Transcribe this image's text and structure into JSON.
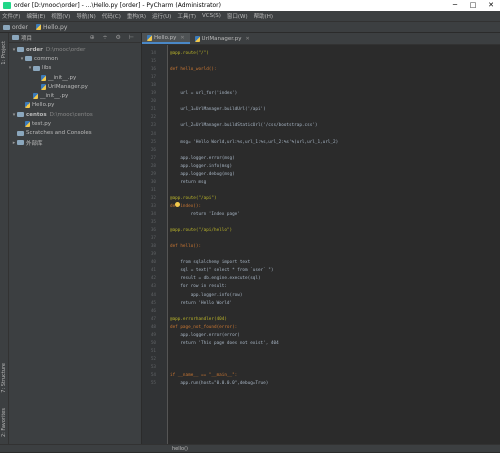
{
  "window": {
    "title": "order [D:\\mooc\\order] - ...\\Hello.py [order] - PyCharm (Administrator)",
    "controls": [
      "─",
      "□",
      "✕"
    ]
  },
  "menu": [
    "文件(F)",
    "编辑(E)",
    "视图(V)",
    "导航(N)",
    "代码(C)",
    "重构(R)",
    "运行(U)",
    "工具(T)",
    "VCS(S)",
    "窗口(W)",
    "帮助(H)"
  ],
  "nav": {
    "project": "order",
    "file": "Hello.py"
  },
  "left_strip": {
    "project": "1: Project",
    "structure": "7: Structure",
    "favorites": "2: Favorites"
  },
  "project_panel": {
    "title": "项目",
    "tools": "⊕ ÷ ⚙ ⊢",
    "tree": [
      {
        "label": "order",
        "path": "D:\\mooc\\order",
        "arrow": "▾",
        "indent": 0,
        "icon": "folder-icon"
      },
      {
        "label": "common",
        "path": "",
        "arrow": "▾",
        "indent": 1,
        "icon": "folder-icon"
      },
      {
        "label": "libs",
        "path": "",
        "arrow": "▾",
        "indent": 2,
        "icon": "folder-icon"
      },
      {
        "label": "__init__.py",
        "path": "",
        "arrow": "",
        "indent": 3,
        "icon": "python-file-icon"
      },
      {
        "label": "UrlManager.py",
        "path": "",
        "arrow": "",
        "indent": 3,
        "icon": "python-file-icon"
      },
      {
        "label": "__init__.py",
        "path": "",
        "arrow": "",
        "indent": 2,
        "icon": "python-file-icon"
      },
      {
        "label": "Hello.py",
        "path": "",
        "arrow": "",
        "indent": 1,
        "icon": "python-file-icon"
      },
      {
        "label": "centos",
        "path": "D:\\mooc\\centos",
        "arrow": "▾",
        "indent": 0,
        "icon": "folder-icon"
      },
      {
        "label": "test.py",
        "path": "",
        "arrow": "",
        "indent": 1,
        "icon": "python-file-icon"
      },
      {
        "label": "Scratches and Consoles",
        "path": "",
        "arrow": "",
        "indent": 0,
        "icon": "scratches-icon"
      },
      {
        "label": "外部库",
        "path": "",
        "arrow": "▸",
        "indent": 0,
        "icon": "library-icon"
      }
    ]
  },
  "tabs": [
    {
      "label": "Hello.py",
      "active": true
    },
    {
      "label": "UrlManager.py",
      "active": false
    }
  ],
  "code": {
    "line_numbers": [
      "14",
      "15",
      "16",
      "17",
      "18",
      "19",
      "20",
      "21",
      "22",
      "23",
      "24",
      "25",
      "26",
      "27",
      "28",
      "29",
      "30",
      "31",
      "32",
      "33",
      "34",
      "35",
      "36",
      "37",
      "38",
      "39",
      "40",
      "41",
      "42",
      "43",
      "44",
      "45",
      "46",
      "47",
      "48",
      "49",
      "50",
      "51",
      "52",
      "53",
      "54",
      "55",
      "56",
      "57",
      "58",
      "59",
      "60"
    ],
    "lines": [
      {
        "t": "@app.route(\"/\")",
        "c": "dec"
      },
      {
        "t": "",
        "c": ""
      },
      {
        "t": "def hello_world():",
        "c": "kw"
      },
      {
        "t": "",
        "c": ""
      },
      {
        "t": "",
        "c": ""
      },
      {
        "t": "    url = url_for('index')",
        "c": ""
      },
      {
        "t": "",
        "c": ""
      },
      {
        "t": "    url_1=UrlManager.buildUrl('/api')",
        "c": ""
      },
      {
        "t": "",
        "c": ""
      },
      {
        "t": "    url_2=UrlManager.buildStaticUrl('/css/bootstrap.css')",
        "c": ""
      },
      {
        "t": "",
        "c": ""
      },
      {
        "t": "    msg= 'Hello World,url:%s,url_1:%s,url_2:%s'%(url,url_1,url_2)",
        "c": ""
      },
      {
        "t": "",
        "c": ""
      },
      {
        "t": "    app.logger.error(msg)",
        "c": ""
      },
      {
        "t": "    app.logger.info(msg)",
        "c": ""
      },
      {
        "t": "    app.logger.debug(msg)",
        "c": ""
      },
      {
        "t": "    return msg",
        "c": ""
      },
      {
        "t": "",
        "c": ""
      },
      {
        "t": "@app.route(\"/api\")",
        "c": "dec"
      },
      {
        "t": "def index():",
        "c": "kw"
      },
      {
        "t": "        return 'Index page'",
        "c": ""
      },
      {
        "t": "",
        "c": ""
      },
      {
        "t": "@app.route(\"/api/hello\")",
        "c": "dec"
      },
      {
        "t": "",
        "c": ""
      },
      {
        "t": "def hello():",
        "c": "kw"
      },
      {
        "t": "",
        "c": ""
      },
      {
        "t": "    from sqlalchemy import text",
        "c": ""
      },
      {
        "t": "    sql = text(\" select * from `user` \")",
        "c": ""
      },
      {
        "t": "    result = db.engine.execute(sql)",
        "c": ""
      },
      {
        "t": "    for row in result:",
        "c": ""
      },
      {
        "t": "        app.logger.info(row)",
        "c": ""
      },
      {
        "t": "    return 'Hello World'",
        "c": ""
      },
      {
        "t": "",
        "c": ""
      },
      {
        "t": "@app.errorhandler(404)",
        "c": "dec"
      },
      {
        "t": "def page_not_found(error):",
        "c": "kw"
      },
      {
        "t": "    app.logger.error(error)",
        "c": ""
      },
      {
        "t": "    return 'This page does not exist', 404",
        "c": ""
      },
      {
        "t": "",
        "c": ""
      },
      {
        "t": "",
        "c": ""
      },
      {
        "t": "",
        "c": ""
      },
      {
        "t": "if __name__ == \"__main__\":",
        "c": "kw"
      },
      {
        "t": "    app.run(host=\"0.0.0.0\",debug=True)",
        "c": ""
      }
    ]
  },
  "status": {
    "breadcrumb": "hello()"
  },
  "colors": {
    "editor_bg": "#2b2b2b",
    "panel_bg": "#3c3f41",
    "decorator": "#bbb529",
    "keyword": "#cc7832",
    "string": "#6a8759"
  }
}
